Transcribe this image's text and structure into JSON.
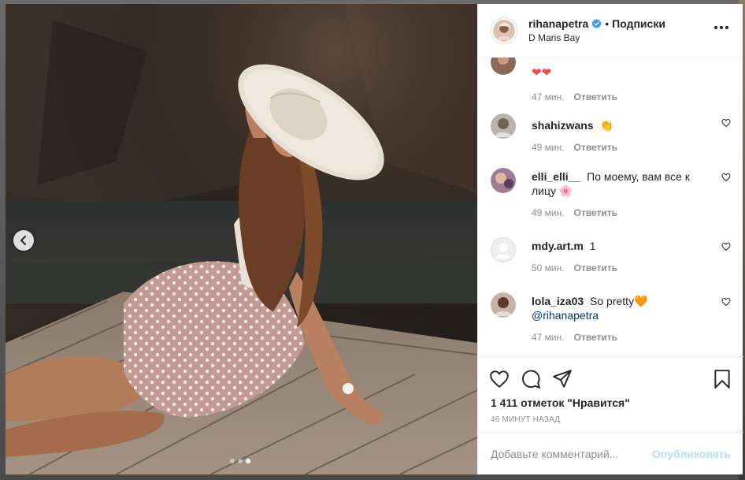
{
  "post": {
    "username": "rihanapetra",
    "follow_label": "Подписки",
    "separator": "•",
    "location": "D Maris Bay"
  },
  "photo": {
    "slide_count": 3,
    "active_slide": 3
  },
  "comments": [
    {
      "user": "",
      "text": "❤❤",
      "time": "47 мин.",
      "reply": "Ответить"
    },
    {
      "user": "shahizwans",
      "text": "👏",
      "time": "49 мин.",
      "reply": "Ответить"
    },
    {
      "user": "elli_elli__",
      "text": "По моему, вам все к лицу 🌸",
      "time": "49 мин.",
      "reply": "Ответить"
    },
    {
      "user": "mdy.art.m",
      "text": "1",
      "time": "50 мин.",
      "reply": "Ответить"
    },
    {
      "user": "lola_iza03",
      "text": "So pretty🧡",
      "mention": "@rihanapetra",
      "time": "47 мин.",
      "reply": "Ответить"
    }
  ],
  "stats": {
    "likes": "1 411 отметок \"Нравится\"",
    "posted": "46 МИНУТ НАЗАД"
  },
  "composer": {
    "placeholder": "Добавьте комментарий...",
    "post_label": "Опубликовать"
  },
  "colors": {
    "verified": "#3897f0",
    "post_disabled": "#b2dffc",
    "text": "#262626",
    "muted": "#8e8e8e"
  },
  "icons": [
    "chevron-left-icon",
    "verified-badge-icon",
    "more-icon",
    "heart-icon",
    "comment-icon",
    "share-icon",
    "bookmark-icon"
  ]
}
